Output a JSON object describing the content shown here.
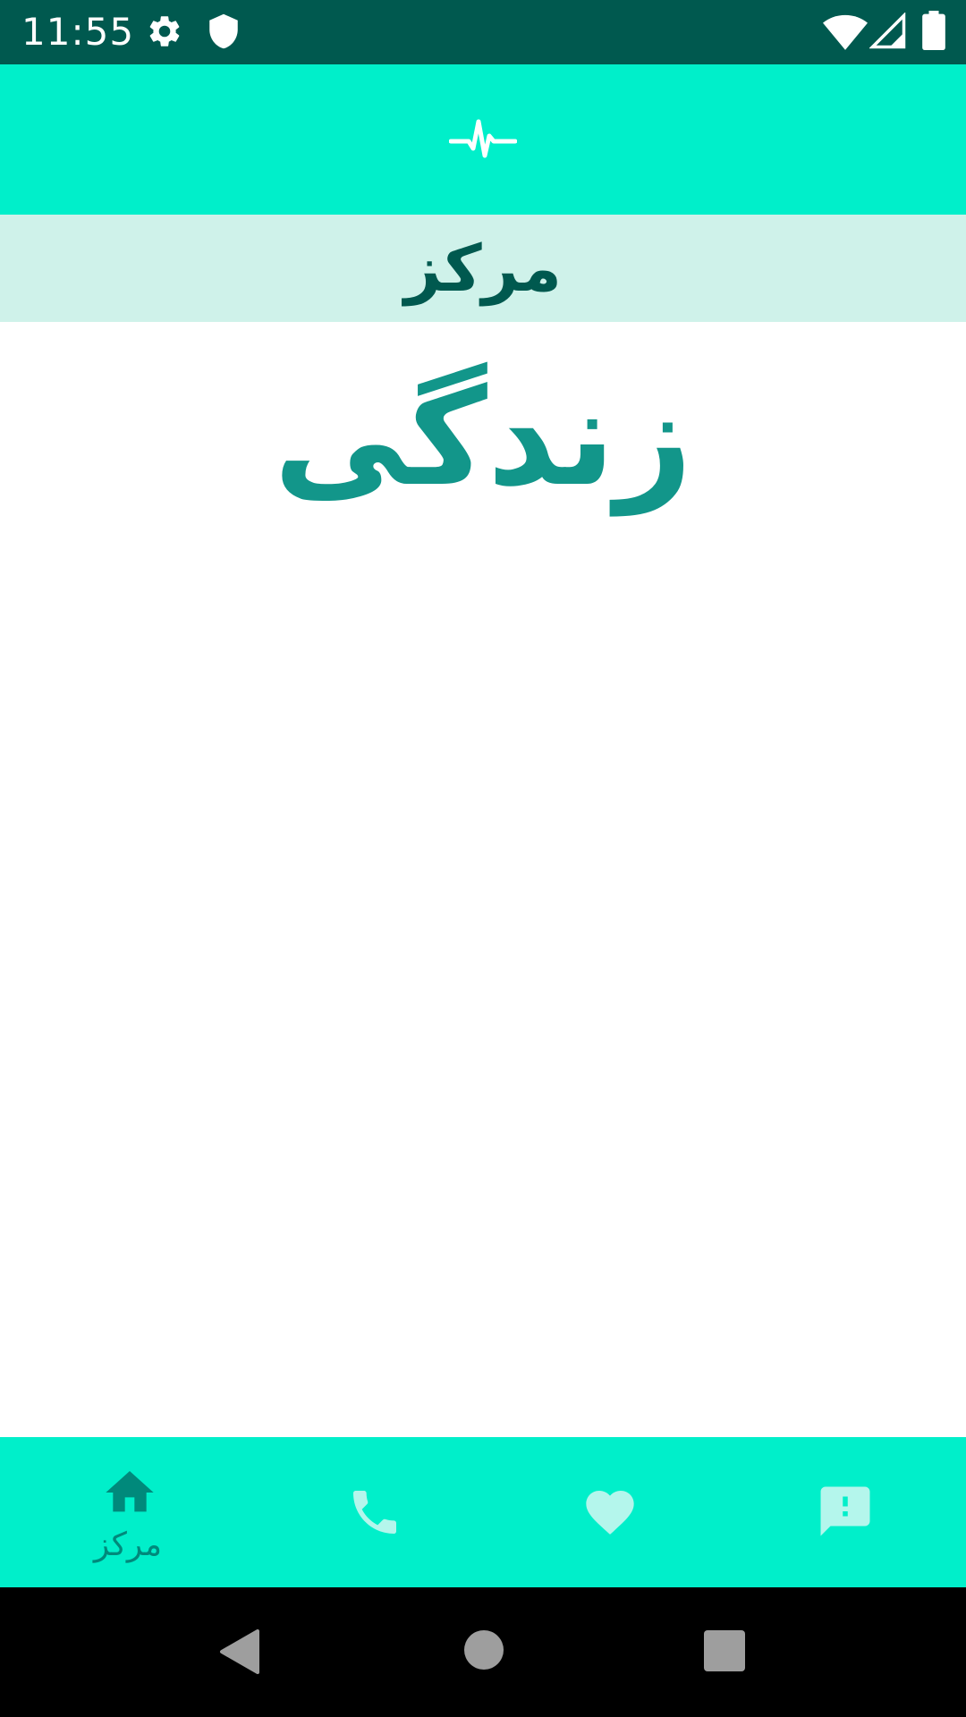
{
  "status_bar": {
    "time": "11:55",
    "icons": [
      "gear-icon",
      "shield-icon",
      "wifi-icon",
      "signal-icon",
      "battery-icon"
    ]
  },
  "app_bar": {
    "logo_icon": "heartbeat-pulse-icon"
  },
  "page": {
    "title": "مرکز",
    "hero_word": "زندگی"
  },
  "bottom_nav": {
    "items": [
      {
        "icon": "home-icon",
        "label": "مرکز",
        "selected": true
      },
      {
        "icon": "phone-icon",
        "label": "",
        "selected": false
      },
      {
        "icon": "heart-icon",
        "label": "",
        "selected": false
      },
      {
        "icon": "feedback-icon",
        "label": "",
        "selected": false
      }
    ]
  },
  "system_nav": {
    "icons": [
      "back-icon",
      "home-circle-icon",
      "recents-icon"
    ]
  },
  "colors": {
    "status_bar": "#00594f",
    "accent": "#00efca",
    "title_band": "#cff2ea",
    "title_text": "#00594f",
    "hero_text": "#12968a",
    "nav_selected": "#00897b",
    "nav_unselected": "#b4f6ec"
  }
}
